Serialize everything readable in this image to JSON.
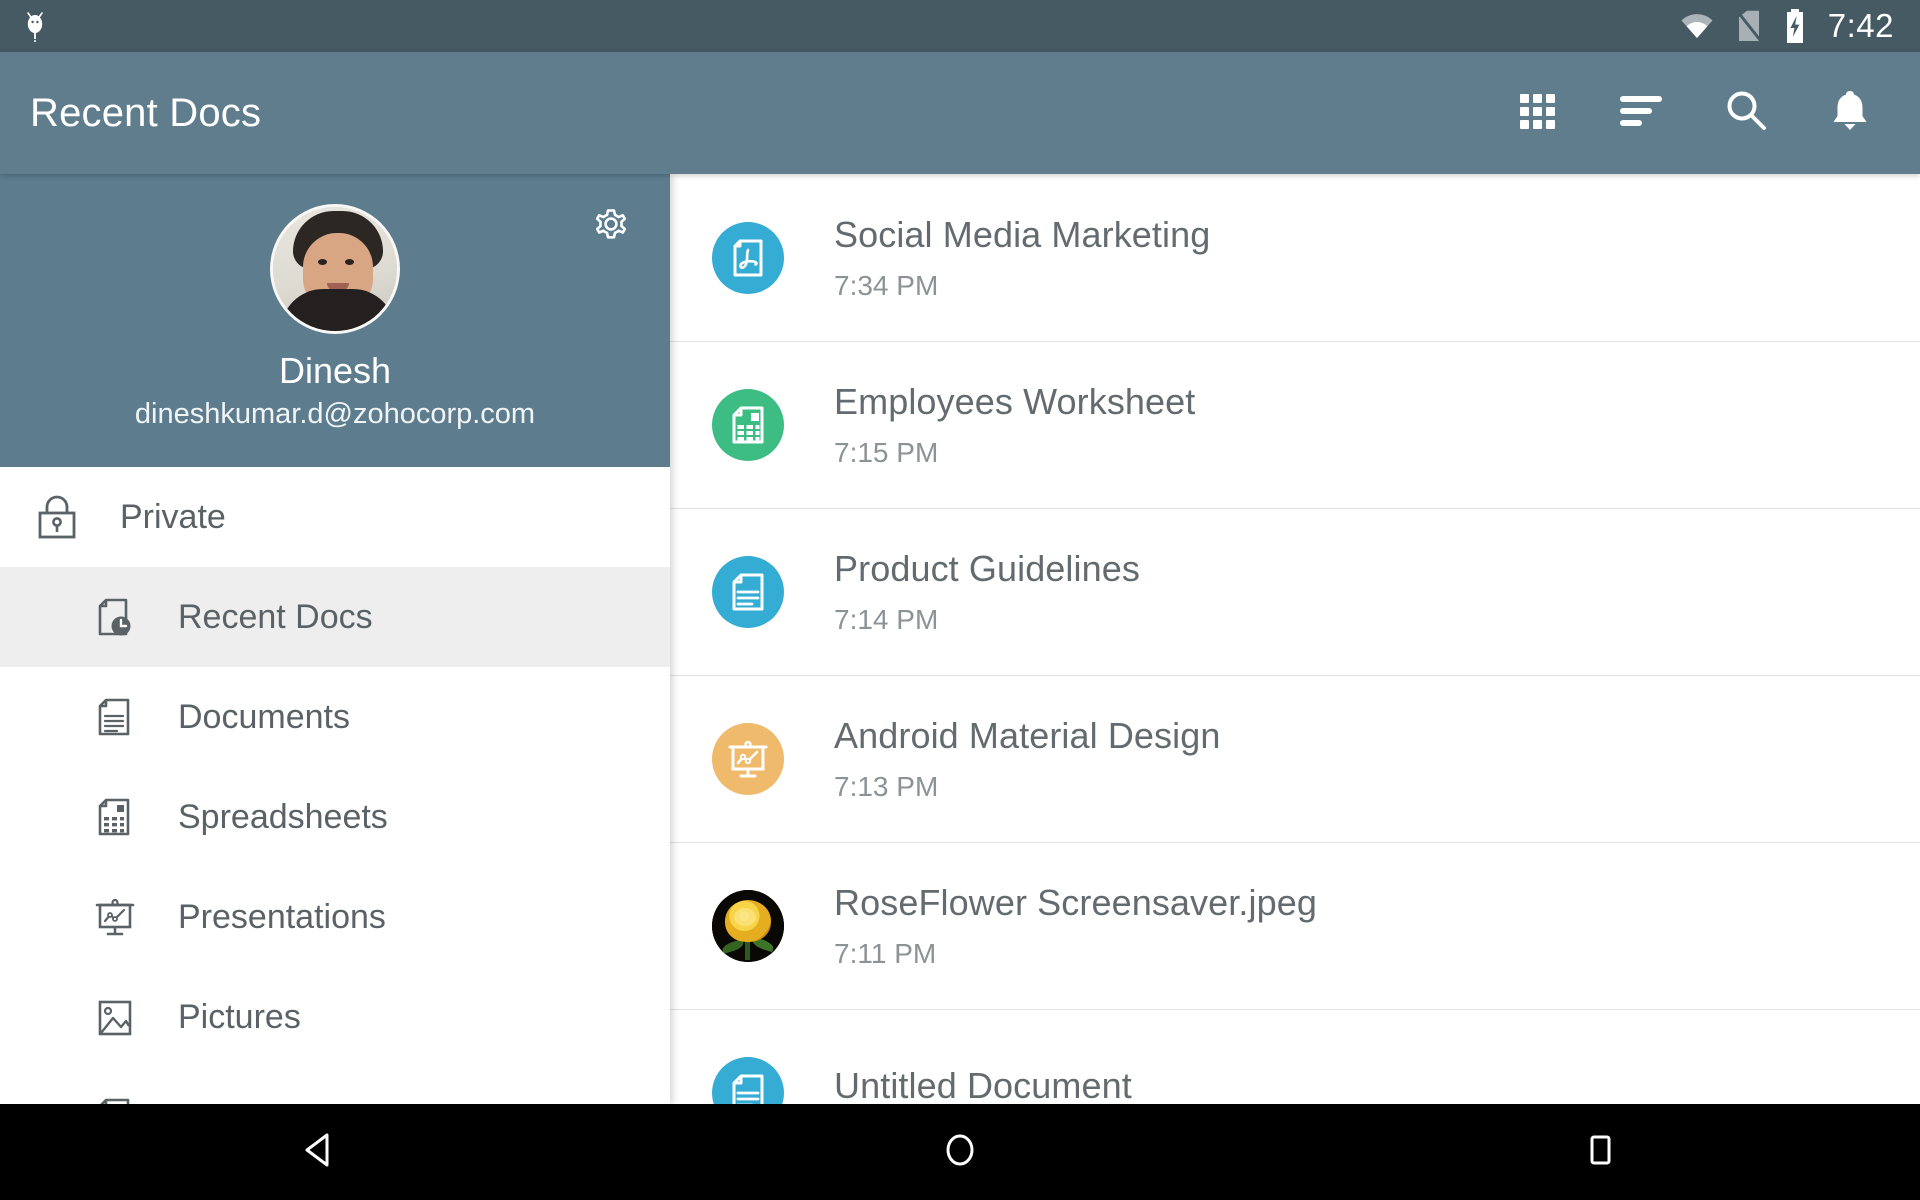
{
  "status_bar": {
    "left_icon": "bug-droid-icon",
    "icons": [
      "wifi-icon",
      "no-sim-icon",
      "battery-charging-icon"
    ],
    "clock": "7:42",
    "background": "#465a64"
  },
  "app_bar": {
    "title": "Recent Docs",
    "background": "#5f7d8c",
    "actions": [
      {
        "name": "grid-view-icon",
        "label": "Grid view"
      },
      {
        "name": "sort-icon",
        "label": "Sort"
      },
      {
        "name": "search-icon",
        "label": "Search"
      },
      {
        "name": "notifications-bell-icon",
        "label": "Notifications"
      }
    ]
  },
  "drawer": {
    "background": "#5d7d8e",
    "settings_icon": "gear-icon",
    "avatar": "user-avatar-photo",
    "name": "Dinesh",
    "email": "dineshkumar.d@zohocorp.com",
    "items": [
      {
        "label": "Private",
        "icon": "lock-icon",
        "level": "root",
        "selected": false
      },
      {
        "label": "Recent Docs",
        "icon": "recent-docs-icon",
        "level": "child",
        "selected": true
      },
      {
        "label": "Documents",
        "icon": "document-icon",
        "level": "child",
        "selected": false
      },
      {
        "label": "Spreadsheets",
        "icon": "spreadsheet-icon",
        "level": "child",
        "selected": false
      },
      {
        "label": "Presentations",
        "icon": "presentation-icon",
        "level": "child",
        "selected": false
      },
      {
        "label": "Pictures",
        "icon": "picture-icon",
        "level": "child",
        "selected": false
      },
      {
        "label": "",
        "icon": "file-icon",
        "level": "child",
        "selected": false
      }
    ]
  },
  "file_list": {
    "items": [
      {
        "name": "Social Media Marketing",
        "time": "7:34 PM",
        "icon": "pdf-file-icon",
        "color": "#35acd4"
      },
      {
        "name": "Employees Worksheet",
        "time": "7:15 PM",
        "icon": "spreadsheet-file-icon",
        "color": "#3dbc84"
      },
      {
        "name": "Product Guidelines",
        "time": "7:14 PM",
        "icon": "document-file-icon",
        "color": "#35acd4"
      },
      {
        "name": "Android Material Design",
        "time": "7:13 PM",
        "icon": "presentation-file-icon",
        "color": "#efba6b"
      },
      {
        "name": "RoseFlower Screensaver.jpeg",
        "time": "7:11 PM",
        "icon": "image-thumbnail",
        "color": "#0a0805"
      },
      {
        "name": "Untitled Document",
        "time": "",
        "icon": "document-file-icon",
        "color": "#35acd4"
      }
    ]
  },
  "nav_bar": {
    "background": "#000000",
    "buttons": [
      {
        "name": "back-button",
        "icon": "triangle-left-icon"
      },
      {
        "name": "home-button",
        "icon": "circle-icon"
      },
      {
        "name": "recents-button",
        "icon": "square-icon"
      }
    ]
  }
}
